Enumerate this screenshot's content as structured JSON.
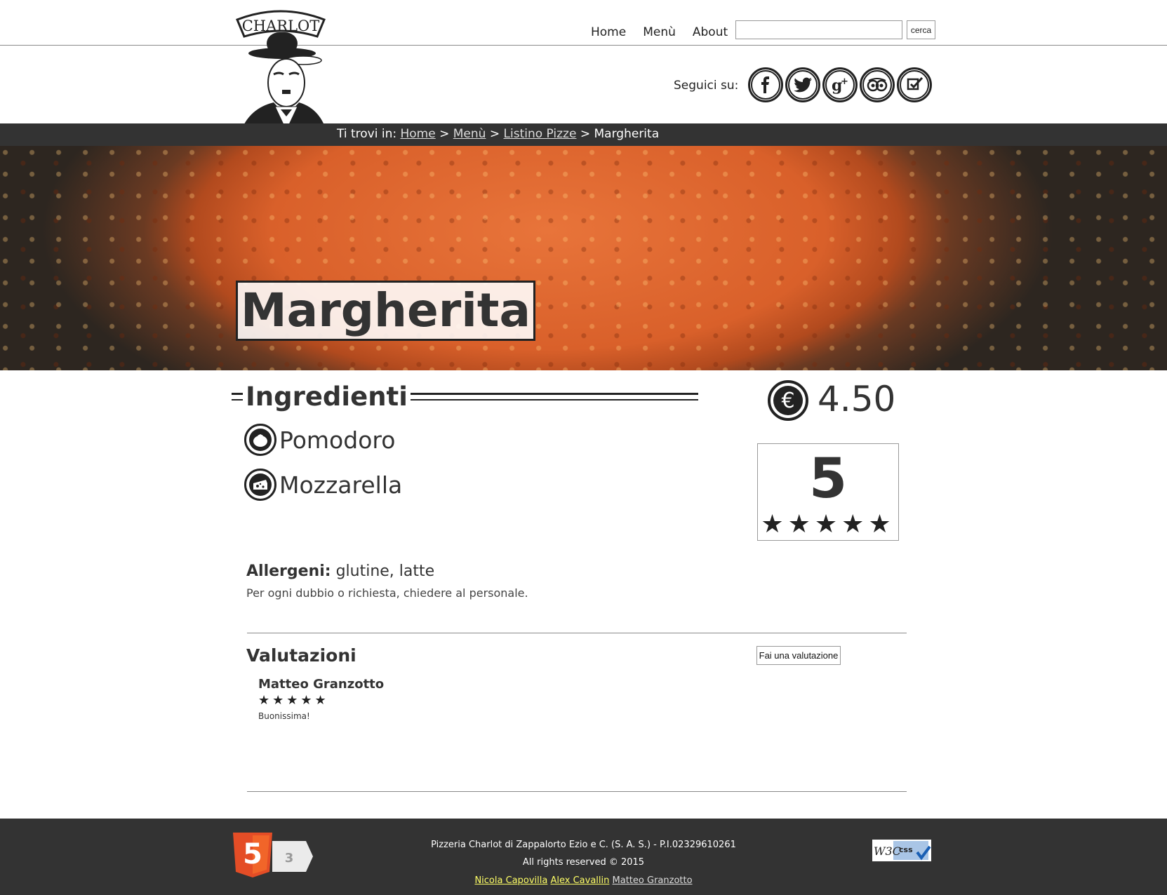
{
  "header": {
    "logo_text": "CHARLOT",
    "nav": [
      "Home",
      "Menù",
      "About"
    ],
    "search": {
      "placeholder": "",
      "button": "cerca"
    },
    "follow_label": "Seguici su:",
    "social": [
      "facebook-icon",
      "twitter-icon",
      "google-plus-icon",
      "tripadvisor-icon",
      "foursquare-icon"
    ]
  },
  "breadcrumb": {
    "prefix": "Ti trovi in:",
    "items": [
      "Home",
      "Menù",
      "Listino Pizze"
    ],
    "current": "Margherita",
    "separator": ">"
  },
  "hero": {
    "title": "Margherita"
  },
  "ingredients": {
    "heading": "Ingredienti",
    "items": [
      {
        "label": "Pomodoro",
        "icon": "tomato-icon"
      },
      {
        "label": "Mozzarella",
        "icon": "cheese-icon"
      }
    ]
  },
  "price": {
    "value": "4.50",
    "icon": "euro-icon"
  },
  "rating": {
    "value": "5",
    "stars": "★★★★★"
  },
  "allergens": {
    "label": "Allergeni:",
    "value": "glutine, latte",
    "note": "Per ogni dubbio o richiesta, chiedere al personale."
  },
  "reviews": {
    "title": "Valutazioni",
    "button": "Fai una valutazione",
    "items": [
      {
        "author": "Matteo Granzotto",
        "stars": "★★★★★",
        "text": "Buonissima!"
      }
    ]
  },
  "footer": {
    "company": "Pizzeria Charlot di Zappalorto Ezio e C. (S. A. S.) - P.I.02329610261",
    "rights": "All rights reserved © 2015",
    "authors": [
      "Nicola Capovilla",
      "Alex Cavallin",
      "Matteo Granzotto"
    ],
    "badge_html5": "5",
    "badge_css": "3",
    "badge_w3c": "W3C",
    "badge_w3c_css": "css"
  },
  "colors": {
    "dark_bar": "#333333",
    "author_link_highlight": "#ffff66",
    "text": "#333333"
  }
}
